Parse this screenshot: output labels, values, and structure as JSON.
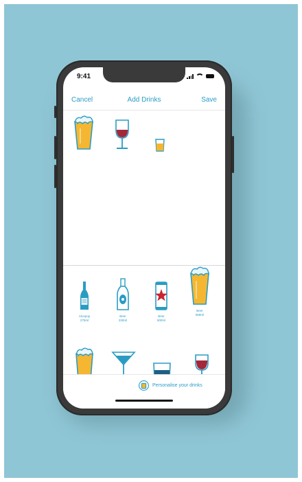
{
  "status_bar": {
    "time": "9:41"
  },
  "nav": {
    "cancel": "Cancel",
    "title": "Add Drinks",
    "save": "Save"
  },
  "selected_drinks": [
    {
      "icon": "beer-pint-icon"
    },
    {
      "icon": "wine-glass-icon"
    },
    {
      "icon": "shot-glass-icon"
    }
  ],
  "palette": [
    {
      "icon": "alcopop-bottle-icon",
      "name": "Alcopop",
      "size": "275ml"
    },
    {
      "icon": "beer-bottle-icon",
      "name": "Beer",
      "size": "330ml"
    },
    {
      "icon": "beer-can-icon",
      "name": "Beer",
      "size": "500ml"
    },
    {
      "icon": "beer-pint-icon",
      "name": "Beer",
      "size": "568ml"
    }
  ],
  "palette_row2": [
    {
      "icon": "beer-pint-icon"
    },
    {
      "icon": "cocktail-glass-icon"
    },
    {
      "icon": "spirit-tumbler-icon"
    },
    {
      "icon": "wine-glass-icon"
    }
  ],
  "footer": {
    "personalise": "Personalise your drinks"
  },
  "colors": {
    "background": "#8fc6d5",
    "accent": "#2a9cc4",
    "beer": "#f5b731",
    "wine": "#a4283a"
  }
}
